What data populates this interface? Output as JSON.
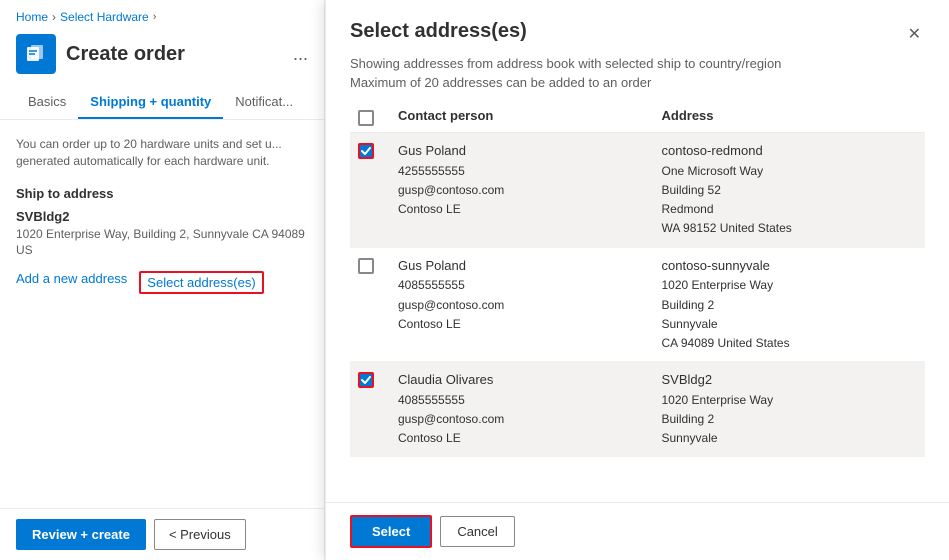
{
  "breadcrumb": {
    "home": "Home",
    "current": "Select Hardware",
    "sep": "›",
    "arrow": "›"
  },
  "order": {
    "title": "Create order",
    "more": "..."
  },
  "tabs": [
    {
      "label": "Basics",
      "active": false
    },
    {
      "label": "Shipping + quantity",
      "active": true
    },
    {
      "label": "Notificat...",
      "active": false
    }
  ],
  "panel": {
    "description": "You can order up to 20 hardware units and set u... generated automatically for each hardware unit.",
    "ship_section_label": "Ship to address",
    "ship_name": "SVBldg2",
    "ship_address": "1020 Enterprise Way, Building 2, Sunnyvale CA 94089 US",
    "add_link": "Add a new address",
    "select_link": "Select address(es)"
  },
  "bottom_bar": {
    "review_btn": "Review + create",
    "prev_btn": "< Previous"
  },
  "modal": {
    "title": "Select address(es)",
    "desc1": "Showing addresses from address book with selected ship to country/region",
    "desc2": "Maximum of 20 addresses can be added to an order",
    "close": "✕",
    "table": {
      "col_check": "",
      "col_contact": "Contact person",
      "col_address": "Address"
    },
    "rows": [
      {
        "checked": true,
        "checked_red_border": true,
        "contact_name": "Gus Poland",
        "contact_phone": "4255555555",
        "contact_email": "gusp@contoso.com",
        "contact_company": "Contoso LE",
        "address_name": "contoso-redmond",
        "address_line1": "One Microsoft Way",
        "address_line2": "Building 52",
        "address_line3": "Redmond",
        "address_line4": "WA 98152 United States"
      },
      {
        "checked": false,
        "checked_red_border": false,
        "contact_name": "Gus Poland",
        "contact_phone": "4085555555",
        "contact_email": "gusp@contoso.com",
        "contact_company": "Contoso LE",
        "address_name": "contoso-sunnyvale",
        "address_line1": "1020 Enterprise Way",
        "address_line2": "Building 2",
        "address_line3": "Sunnyvale",
        "address_line4": "CA 94089 United States"
      },
      {
        "checked": true,
        "checked_red_border": true,
        "contact_name": "Claudia Olivares",
        "contact_phone": "4085555555",
        "contact_email": "gusp@contoso.com",
        "contact_company": "Contoso LE",
        "address_name": "SVBldg2",
        "address_line1": "1020 Enterprise Way",
        "address_line2": "Building 2",
        "address_line3": "Sunnyvale",
        "address_line4": ""
      }
    ],
    "select_btn": "Select",
    "cancel_btn": "Cancel"
  }
}
